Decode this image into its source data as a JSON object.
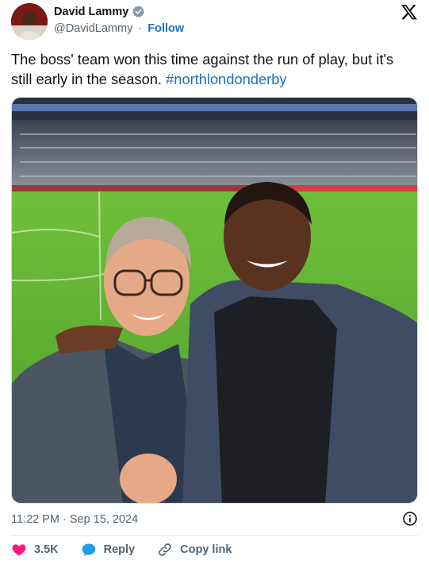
{
  "author": {
    "name": "David Lammy",
    "handle": "@DavidLammy",
    "separator": "·",
    "follow_label": "Follow"
  },
  "tweet": {
    "text": "The boss' team won this time against the run of play, but it's still early in the season. ",
    "hashtag": "#northlondonderby"
  },
  "meta": {
    "timestamp": "11:22 PM · Sep 15, 2024"
  },
  "actions": {
    "likes_count": "3.5K",
    "reply_label": "Reply",
    "copy_link_label": "Copy link"
  },
  "colors": {
    "accent": "#1d70c4",
    "like": "#f91880",
    "reply": "#1d9bf0",
    "verified": "#829aab"
  },
  "icons": [
    "verified-icon",
    "x-logo-icon",
    "info-icon",
    "heart-icon",
    "reply-bubble-icon",
    "link-icon"
  ]
}
